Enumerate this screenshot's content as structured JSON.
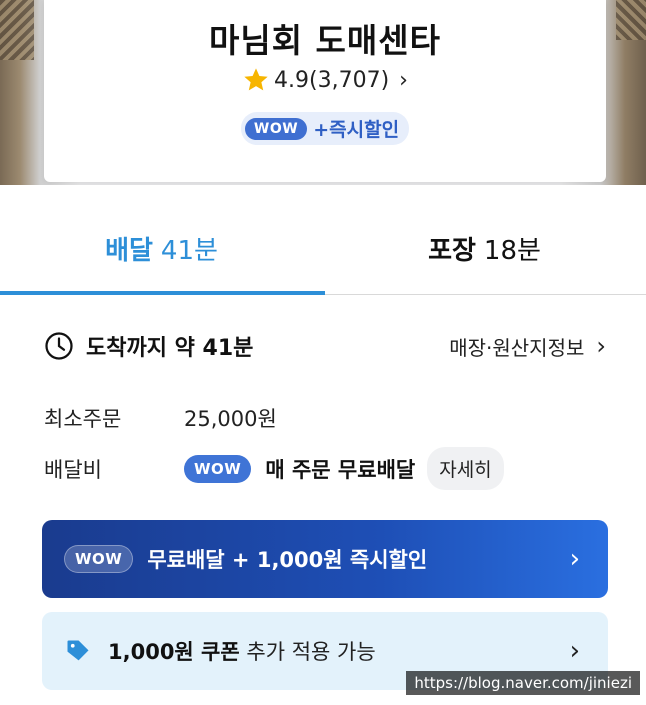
{
  "store": {
    "name": "마님회 도매센타",
    "rating": "4.9(3,707)",
    "wow_label": "WOW",
    "wow_benefit": "+즉시할인"
  },
  "tabs": [
    {
      "label": "배달",
      "time": "41분",
      "active": true
    },
    {
      "label": "포장",
      "time": "18분",
      "active": false
    }
  ],
  "arrival": {
    "text": "도착까지 약 41분",
    "store_info_link": "매장·원산지정보"
  },
  "order_info": {
    "min_order_label": "최소주문",
    "min_order_value": "25,000원",
    "delivery_fee_label": "배달비",
    "delivery_fee_wow": "WOW",
    "delivery_fee_text": "매 주문 무료배달",
    "detail_button": "자세히"
  },
  "promo": {
    "wow_label": "WOW",
    "text": "무료배달 + 1,000원 즉시할인"
  },
  "coupon": {
    "bold_text": "1,000원 쿠폰",
    "text": "추가 적용 가능"
  },
  "watermark": "https://blog.naver.com/jiniezi",
  "colors": {
    "accent_blue": "#2d8fd8",
    "wow_blue": "#3f74d6",
    "promo_navy": "#1a3b8e",
    "coupon_bg": "#e3f2fb",
    "star": "#f7b500"
  },
  "icons": {
    "star": "star-icon",
    "clock": "clock-icon",
    "tag": "coupon-tag-icon",
    "chevron": "chevron-right-icon"
  }
}
